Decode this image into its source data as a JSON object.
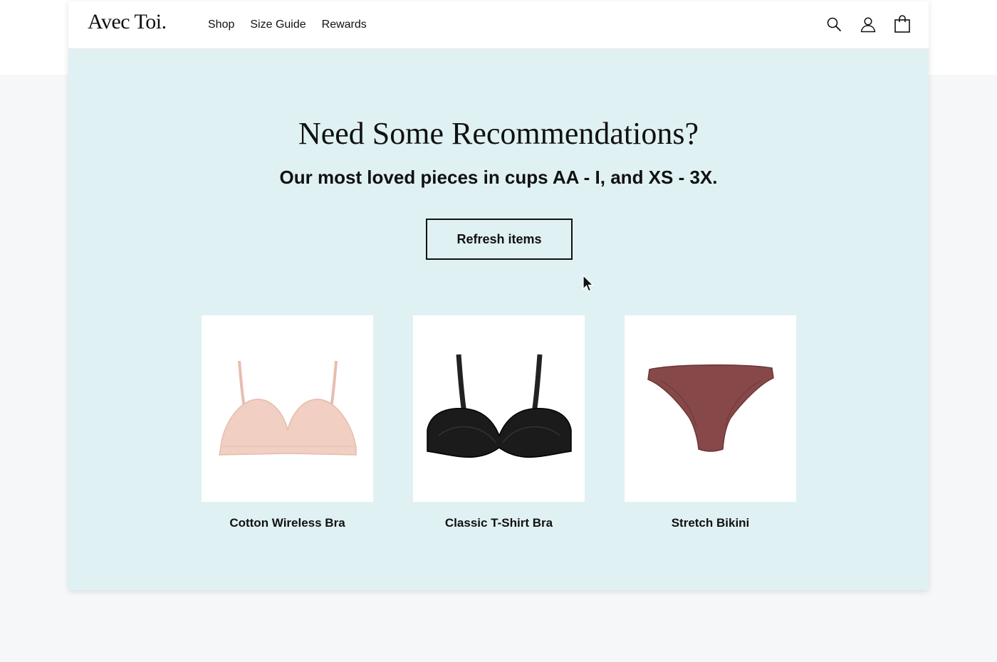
{
  "header": {
    "logo": "Avec Toi.",
    "nav": [
      "Shop",
      "Size Guide",
      "Rewards"
    ],
    "icons": [
      "search-icon",
      "account-icon",
      "shopping-bag-icon"
    ]
  },
  "main": {
    "title": "Need Some Recommendations?",
    "subtitle": "Our most loved pieces in cups AA - I, and XS - 3X.",
    "refresh_label": "Refresh items"
  },
  "products": [
    {
      "name": "Cotton Wireless Bra",
      "color": "#f1cfc3"
    },
    {
      "name": "Classic T-Shirt Bra",
      "color": "#1b1b1b"
    },
    {
      "name": "Stretch Bikini",
      "color": "#864848"
    }
  ],
  "colors": {
    "section_bg": "#e0f1f3",
    "page_bg": "#f5f7f9",
    "text": "#111111"
  }
}
